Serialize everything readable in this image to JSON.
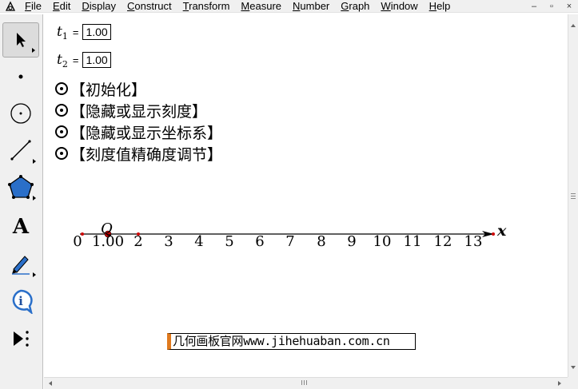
{
  "menu": {
    "items": [
      "File",
      "Edit",
      "Display",
      "Construct",
      "Transform",
      "Measure",
      "Number",
      "Graph",
      "Window",
      "Help"
    ]
  },
  "window_controls": {
    "minimize": "–",
    "restore": "▫",
    "close": "×"
  },
  "toolbox": {
    "tools": [
      {
        "name": "selection-arrow",
        "icon": "arrow-cursor-icon",
        "active": true
      },
      {
        "name": "point",
        "icon": "point-icon"
      },
      {
        "name": "compass",
        "icon": "circle-icon"
      },
      {
        "name": "straightedge",
        "icon": "line-icon"
      },
      {
        "name": "polygon",
        "icon": "polygon-icon"
      },
      {
        "name": "text",
        "icon": "text-a-icon",
        "glyph": "A"
      },
      {
        "name": "marker",
        "icon": "pen-icon"
      },
      {
        "name": "information",
        "icon": "info-icon",
        "glyph": "i"
      },
      {
        "name": "custom",
        "icon": "custom-tools-icon"
      }
    ]
  },
  "params": [
    {
      "name": "t",
      "sub": "1",
      "eq": "=",
      "value": "1.00"
    },
    {
      "name": "t",
      "sub": "2",
      "eq": "=",
      "value": "1.00"
    }
  ],
  "actions": [
    {
      "label": "【初始化】"
    },
    {
      "label": "【隐藏或显示刻度】"
    },
    {
      "label": "【隐藏或显示坐标系】"
    },
    {
      "label": "【刻度值精确度调节】"
    }
  ],
  "axis": {
    "ticks": [
      "0",
      "2",
      "3",
      "4",
      "5",
      "6",
      "7",
      "8",
      "9",
      "10",
      "11",
      "12",
      "13"
    ],
    "x_label": "x",
    "point_label": "Q",
    "point_value": "1.00",
    "colors": {
      "axis": "#000000",
      "point": "#cc0000"
    }
  },
  "caption": {
    "cn": "几何画板官网",
    "url": "www.jihehuaban.com.cn"
  },
  "colors": {
    "caption_accent": "#e07a1e",
    "point_red": "#cc0000"
  }
}
